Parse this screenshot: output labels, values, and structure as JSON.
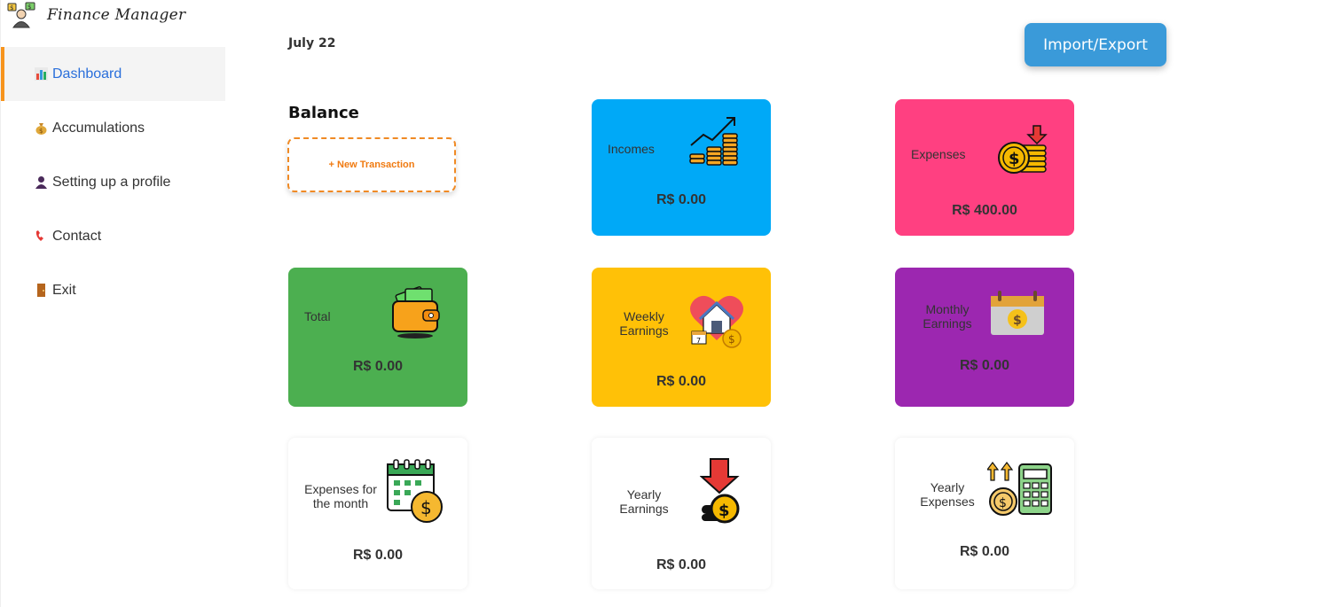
{
  "app": {
    "title": "Finance Manager"
  },
  "sidebar": {
    "items": [
      {
        "label": "Dashboard",
        "icon": "bar-chart-icon",
        "active": true
      },
      {
        "label": "Accumulations",
        "icon": "money-bag-icon"
      },
      {
        "label": "Setting up a profile",
        "icon": "user-icon"
      },
      {
        "label": "Contact",
        "icon": "phone-icon"
      },
      {
        "label": "Exit",
        "icon": "door-icon"
      }
    ]
  },
  "header": {
    "date": "July 22",
    "import_export_label": "Import/Export"
  },
  "balance": {
    "title": "Balance",
    "new_transaction_label": "+ New Transaction"
  },
  "cards": {
    "incomes": {
      "label": "Incomes",
      "value": "R$ 0.00",
      "color": "#00a9f7"
    },
    "expenses": {
      "label": "Expenses",
      "value": "R$ 400.00",
      "color": "#ff4081"
    },
    "total": {
      "label": "Total",
      "value": "R$ 0.00",
      "color": "#4caf50"
    },
    "weekly_earnings": {
      "label": "Weekly Earnings",
      "value": "R$ 0.00",
      "color": "#ffc107"
    },
    "monthly_earnings": {
      "label": "Monthly Earnings",
      "value": "R$ 0.00",
      "color": "#9c27b0"
    },
    "expenses_month": {
      "label": "Expenses for the month",
      "value": "R$ 0.00",
      "color": "#ffffff"
    },
    "yearly_earnings": {
      "label": "Yearly Earnings",
      "value": "R$ 0.00",
      "color": "#ffffff"
    },
    "yearly_expenses": {
      "label": "Yearly Expenses",
      "value": "R$ 0.00",
      "color": "#ffffff"
    }
  }
}
